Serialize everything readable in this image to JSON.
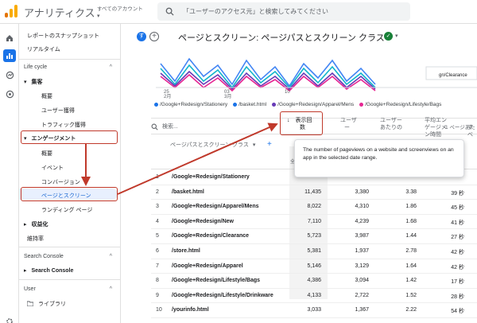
{
  "app": {
    "title": "アナリティクス",
    "account_label": "すべてのアカウント",
    "account_caret": "▾",
    "search_placeholder": "「ユーザーのアクセス元」と検索してみてください"
  },
  "rail": {
    "icons": [
      "home-icon",
      "reports-icon",
      "explore-icon",
      "advertising-icon",
      "settings-icon"
    ]
  },
  "nav": {
    "snapshot": "レポートのスナップショット",
    "realtime": "リアルタイム",
    "lifecycle": "Life cycle",
    "acquisition": "集客",
    "acq_items": [
      "概要",
      "ユーザー獲得",
      "トラフィック獲得"
    ],
    "engagement": "エンゲージメント",
    "eng_items": [
      "概要",
      "イベント",
      "コンバージョン",
      "ページとスクリーン",
      "ランディング ページ"
    ],
    "monetization": "収益化",
    "retention": "維持率",
    "search_console_header": "Search Console",
    "search_console_item": "Search Console",
    "user_header": "User",
    "library": "ライブラリ",
    "caret_up": "^",
    "caret_right": "▸",
    "caret_down": "▾"
  },
  "header": {
    "avatar_letter": "す",
    "add_symbol": "+",
    "title": "ページとスクリーン: ページパスとスクリーン クラス",
    "check_symbol": "✓",
    "caret": "▾"
  },
  "chart_data": {
    "type": "line",
    "x_ticks": [
      {
        "day": "25",
        "month": "2月"
      },
      {
        "day": "03",
        "month": "3月"
      },
      {
        "day": "10",
        "month": ""
      }
    ],
    "series": [
      {
        "name": "/Google+Redesign/Stationery",
        "color": "#4285f4"
      },
      {
        "name": "/basket.html",
        "color": "#12b5cb"
      },
      {
        "name": "/Google+Redesign/Apparel/Mens",
        "color": "#673ab7"
      },
      {
        "name": "/Google+Redesign/Clearance",
        "color": "#e52592"
      }
    ],
    "overflow_label": "gn/Clearance"
  },
  "legend": [
    {
      "name": "/Google+Redesign/Stationery",
      "color": "#1a73e8"
    },
    {
      "name": "/basket.html",
      "color": "#1a73e8"
    },
    {
      "name": "/Google+Redesign/Apparel/Mens",
      "color": "#673ab7"
    },
    {
      "name": "/Google+Redesign/Lifestyle/Bags",
      "color": "#e52592"
    }
  ],
  "table": {
    "search_placeholder": "検索...",
    "pager": "1 ページあた",
    "dimension_header": "ページパスとスクリーン クラス",
    "dim_caret": "▾",
    "plus": "+",
    "sort_arrow": "↓",
    "views_header_line1": "表示回",
    "views_header_line2": "数",
    "col2_line1": "ユーザ",
    "col2_line2": "ー",
    "col3_line1": "ユーザー",
    "col3_line2": "あたりの",
    "col4_line1": "平均エン",
    "col4_line2": "ゲージメ",
    "col4_line3": "ン時間",
    "col5": "すべ",
    "total_label": "全体",
    "tooltip": "The number of pageviews on a website and screenviews on an app in the selected date range.",
    "rows": [
      {
        "idx": "1",
        "path": "/Google+Redesign/Stationery",
        "views": "",
        "users": "",
        "per_user": "",
        "time": ""
      },
      {
        "idx": "2",
        "path": "/basket.html",
        "views": "11,435",
        "users": "3,380",
        "per_user": "3.38",
        "time": "39 秒"
      },
      {
        "idx": "3",
        "path": "/Google+Redesign/Apparel/Mens",
        "views": "8,022",
        "users": "4,310",
        "per_user": "1.86",
        "time": "45 秒"
      },
      {
        "idx": "4",
        "path": "/Google+Redesign/New",
        "views": "7,110",
        "users": "4,239",
        "per_user": "1.68",
        "time": "41 秒"
      },
      {
        "idx": "5",
        "path": "/Google+Redesign/Clearance",
        "views": "5,723",
        "users": "3,987",
        "per_user": "1.44",
        "time": "27 秒"
      },
      {
        "idx": "6",
        "path": "/store.html",
        "views": "5,381",
        "users": "1,937",
        "per_user": "2.78",
        "time": "42 秒"
      },
      {
        "idx": "7",
        "path": "/Google+Redesign/Apparel",
        "views": "5,146",
        "users": "3,129",
        "per_user": "1.64",
        "time": "42 秒"
      },
      {
        "idx": "8",
        "path": "/Google+Redesign/Lifestyle/Bags",
        "views": "4,386",
        "users": "3,094",
        "per_user": "1.42",
        "time": "17 秒"
      },
      {
        "idx": "9",
        "path": "/Google+Redesign/Lifestyle/Drinkware",
        "views": "4,133",
        "users": "2,722",
        "per_user": "1.52",
        "time": "28 秒"
      },
      {
        "idx": "10",
        "path": "/yourinfo.html",
        "views": "3,033",
        "users": "1,367",
        "per_user": "2.22",
        "time": "54 秒"
      }
    ]
  },
  "colors": {
    "accent": "#1a73e8",
    "highlight_border": "#c0392b",
    "selected_bg": "#e8f0fe"
  }
}
